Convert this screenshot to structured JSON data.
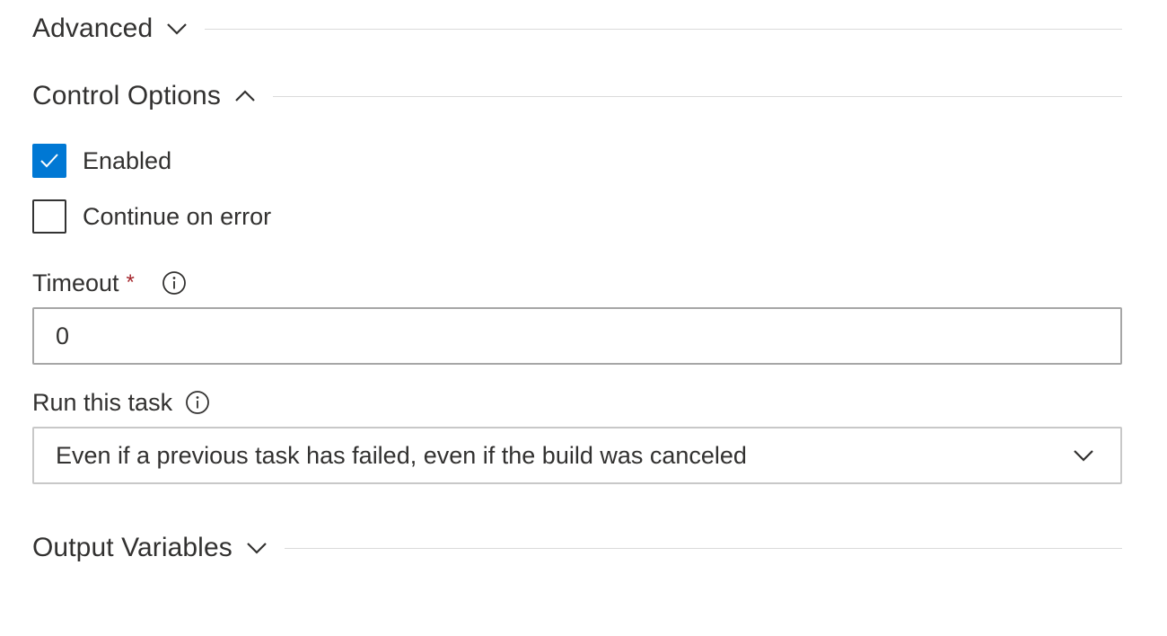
{
  "sections": {
    "advanced": {
      "title": "Advanced",
      "expanded": false
    },
    "control_options": {
      "title": "Control Options",
      "expanded": true
    },
    "output_variables": {
      "title": "Output Variables",
      "expanded": false
    }
  },
  "control_options": {
    "enabled": {
      "label": "Enabled",
      "checked": true
    },
    "continue_on_error": {
      "label": "Continue on error",
      "checked": false
    },
    "timeout": {
      "label": "Timeout",
      "required_marker": "*",
      "value": "0"
    },
    "run_this_task": {
      "label": "Run this task",
      "selected": "Even if a previous task has failed, even if the build was canceled"
    }
  },
  "icons": {
    "section_collapsed": "chevron-down-icon",
    "section_expanded": "chevron-up-icon",
    "checkbox_check": "checkmark-icon",
    "info": "info-icon",
    "dropdown": "chevron-down-icon"
  },
  "colors": {
    "accent": "#0078d4",
    "required": "#a4262c",
    "text": "#323130",
    "divider": "#dadada",
    "input_border": "#a6a6a6"
  }
}
